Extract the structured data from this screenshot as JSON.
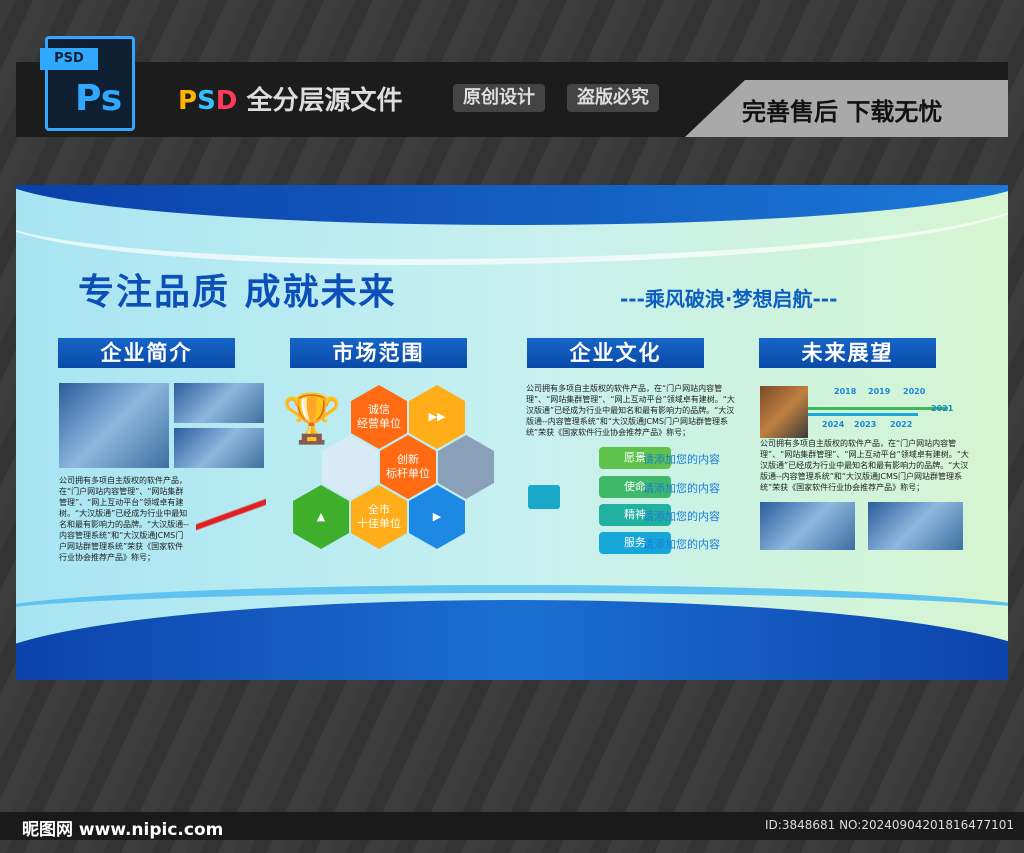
{
  "banner": {
    "ps_label": "PSD",
    "ps_glyph": "Ps",
    "title_psd": [
      "P",
      "S",
      "D"
    ],
    "title_rest": " 全分层源文件",
    "tags": [
      "原创设计",
      "盗版必究"
    ],
    "after_sale": "完善售后 下载无忧"
  },
  "board": {
    "title": "专注品质 成就未来",
    "slogan": "---乘风破浪·梦想启航---",
    "sections": [
      {
        "heading": "企业简介",
        "text": "公司拥有多项自主版权的软件产品，在“门户网站内容管理”、“网站集群管理”、“网上互动平台”领域卓有建树。“大汉版通”已经成为行业中最知名和最有影响力的品牌。“大汉版通--内容管理系统”和“大汉版通JCMS门户网站群管理系统”荣获《国家软件行业协会推荐产品》称号；"
      },
      {
        "heading": "市场范围",
        "hexes": [
          "诚信\n经营单位",
          "创新\n标杆单位",
          "全市\n十佳单位"
        ]
      },
      {
        "heading": "企业文化",
        "text": "公司拥有多项自主版权的软件产品，在“门户网站内容管理”、“网站集群管理”、“网上互动平台”领域卓有建树。“大汉版通”已经成为行业中最知名和最有影响力的品牌。“大汉版通--内容管理系统”和“大汉版通JCMS门户网站群管理系统”荣获《国家软件行业协会推荐产品》称号；",
        "items": [
          {
            "label": "愿景",
            "content": "请添加您的内容"
          },
          {
            "label": "使命",
            "content": "请添加您的内容"
          },
          {
            "label": "精神",
            "content": "请添加您的内容"
          },
          {
            "label": "服务",
            "content": "请添加您的内容"
          }
        ]
      },
      {
        "heading": "未来展望",
        "years_top": [
          "2018",
          "2019",
          "2020"
        ],
        "year_end": "2021",
        "years_bottom": [
          "2024",
          "2023",
          "2022"
        ],
        "text": "公司拥有多项自主版权的软件产品，在“门户网站内容管理”、“网站集群管理”、“网上互动平台”领域卓有建树。“大汉版通”已经成为行业中最知名和最有影响力的品牌。“大汉版通--内容管理系统”和“大汉版通JCMS门户网站群管理系统”荣获《国家软件行业协会推荐产品》称号；"
      }
    ]
  },
  "footer": {
    "logo": "昵图网 www.nipic.com",
    "id": "ID:3848681 NO:20240904201816477101"
  },
  "colors": {
    "accent": "#0c4fb8",
    "heading_bg": "#1565c8"
  }
}
